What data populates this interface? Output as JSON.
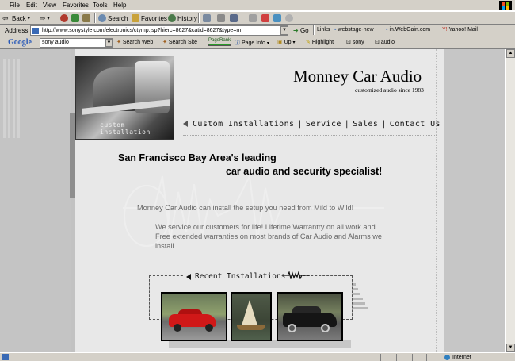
{
  "browser": {
    "menu": [
      "File",
      "Edit",
      "View",
      "Favorites",
      "Tools",
      "Help"
    ],
    "toolbar": {
      "back_label": "Back",
      "search_label": "Search",
      "favorites_label": "Favorites",
      "history_label": "History"
    },
    "address": {
      "label": "Address",
      "value": "http://www.sonystyle.com/electronics/ctymp.jsp?hierc=8627&catid=8627&type=m",
      "go_label": "Go"
    },
    "links": {
      "label": "Links",
      "items": [
        "webstage-new",
        "in.WebGain.com",
        "Yahoo! Mail"
      ]
    },
    "google": {
      "logo": "Google",
      "search_value": "sony audio",
      "search_web_label": "Search Web",
      "search_site_label": "Search Site",
      "pagerank_label": "PageRank",
      "page_info_label": "Page Info",
      "up_label": "Up",
      "highlight_label": "Highlight",
      "term1": "sony",
      "term2": "audio"
    },
    "status": {
      "zone_label": "Internet"
    }
  },
  "site": {
    "hero_caption": "custom installation",
    "title": "Monney Car Audio",
    "tagline": "customized audio since 1983",
    "nav": [
      "Custom Installations",
      "Service",
      "Sales",
      "Contact Us"
    ],
    "headline_line1": "San Francisco Bay Area's leading",
    "headline_line2": "car audio and security specialist!",
    "intro": "Monney Car Audio can install the setup you need from Mild to Wild!",
    "service_text": "We service our customers for life! Lifetime Warrantry on all work and Free extended warranties on most brands of Car Audio and Alarms we install.",
    "recent_label": "Recent Installations"
  },
  "colors": {
    "page_bg": "#e8e8e8",
    "chrome_bg": "#d4d0c8",
    "body_text_grey": "#666666",
    "side_panel": "#c4c4c4"
  }
}
